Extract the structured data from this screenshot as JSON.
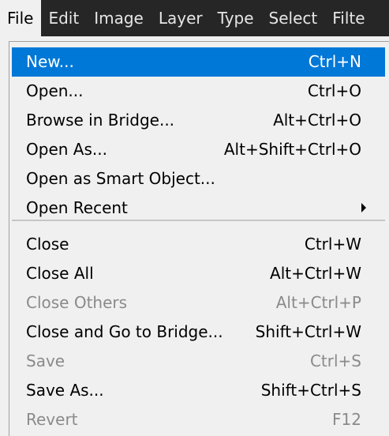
{
  "menubar": {
    "items": [
      "File",
      "Edit",
      "Image",
      "Layer",
      "Type",
      "Select",
      "Filte"
    ]
  },
  "file_menu": {
    "items": [
      {
        "label": "New...",
        "shortcut": "Ctrl+N"
      },
      {
        "label": "Open...",
        "shortcut": "Ctrl+O"
      },
      {
        "label": "Browse in Bridge...",
        "shortcut": "Alt+Ctrl+O"
      },
      {
        "label": "Open As...",
        "shortcut": "Alt+Shift+Ctrl+O"
      },
      {
        "label": "Open as Smart Object...",
        "shortcut": ""
      },
      {
        "label": "Open Recent",
        "shortcut": ""
      },
      {
        "label": "Close",
        "shortcut": "Ctrl+W"
      },
      {
        "label": "Close All",
        "shortcut": "Alt+Ctrl+W"
      },
      {
        "label": "Close Others",
        "shortcut": "Alt+Ctrl+P"
      },
      {
        "label": "Close and Go to Bridge...",
        "shortcut": "Shift+Ctrl+W"
      },
      {
        "label": "Save",
        "shortcut": "Ctrl+S"
      },
      {
        "label": "Save As...",
        "shortcut": "Shift+Ctrl+S"
      },
      {
        "label": "Revert",
        "shortcut": "F12"
      }
    ]
  }
}
